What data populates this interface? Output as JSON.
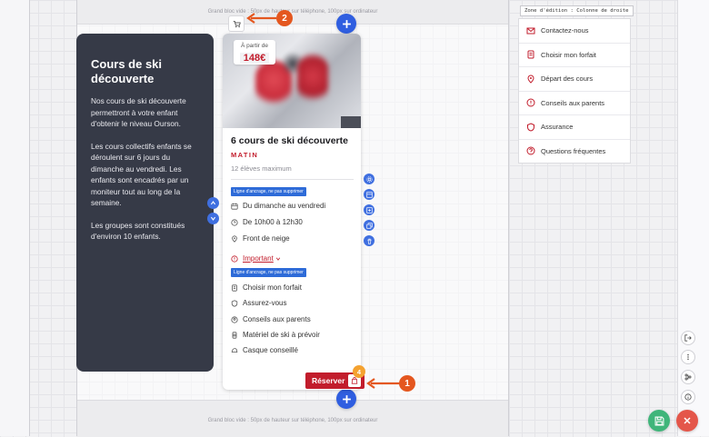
{
  "canvas": {
    "note_top": "Grand bloc vide : 50px de hauteur sur téléphone, 100px sur ordinateur",
    "note_bottom": "Grand bloc vide : 50px de hauteur sur téléphone, 100px sur ordinateur"
  },
  "left_panel": {
    "title": "Cours de ski découverte",
    "paragraphs": [
      "Nos cours de ski découverte permettront à votre enfant d'obtenir le niveau Ourson.",
      "Les cours collectifs enfants se déroulent sur 6 jours du dimanche au vendredi. Les enfants sont encadrés par un moniteur tout au long de la semaine.",
      "Les groupes sont constitués d'environ 10 enfants."
    ]
  },
  "card": {
    "price_from": "À partir de",
    "price": "148€",
    "title": "6 cours de ski découverte",
    "period": "MATIN",
    "capacity": "12 élèves maximum",
    "anchor_label": "Ligne d'ancrage, ne pas supprimer",
    "schedule": [
      "Du dimanche au vendredi",
      "De 10h00 à 12h30",
      "Front de neige"
    ],
    "important": "Important",
    "extras": [
      "Choisir mon forfait",
      "Assurez-vous",
      "Conseils aux parents",
      "Matériel de ski à prévoir",
      "Casque conseillé"
    ],
    "reserve_label": "Réserver"
  },
  "callouts": {
    "one": "1",
    "two": "2",
    "four": "4"
  },
  "right_column": {
    "zone_label": "Zone d'édition : Colonne de droite",
    "items": [
      "Contactez-nous",
      "Choisir mon forfait",
      "Départ des cours",
      "Conseils aux parents",
      "Assurance",
      "Questions fréquentes"
    ]
  },
  "colors": {
    "accent_red": "#c21d2c",
    "accent_blue": "#2f5ee0",
    "callout_orange": "#e4571f",
    "dark_panel": "#363a47"
  }
}
